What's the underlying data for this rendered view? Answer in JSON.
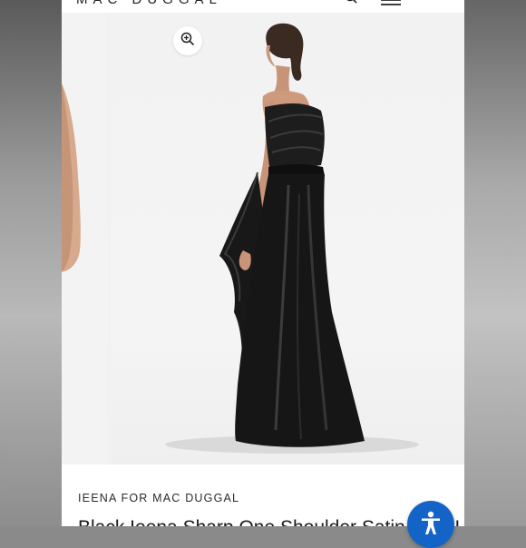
{
  "header": {
    "brand_logo": "MAC DUGGAL",
    "search_icon": "search-icon",
    "menu_icon": "hamburger-menu-icon"
  },
  "gallery": {
    "zoom_icon": "zoom-in-icon",
    "main_image": "model wearing black one-shoulder satin high-low gown, back view"
  },
  "product": {
    "brand": "IEENA FOR MAC DUGGAL",
    "title": "Black Ieena Sharp One Shoulder Satin High Low Gown"
  },
  "accessibility": {
    "icon": "accessibility-icon"
  },
  "colors": {
    "accent": "#1464c8",
    "dress": "#151515"
  }
}
